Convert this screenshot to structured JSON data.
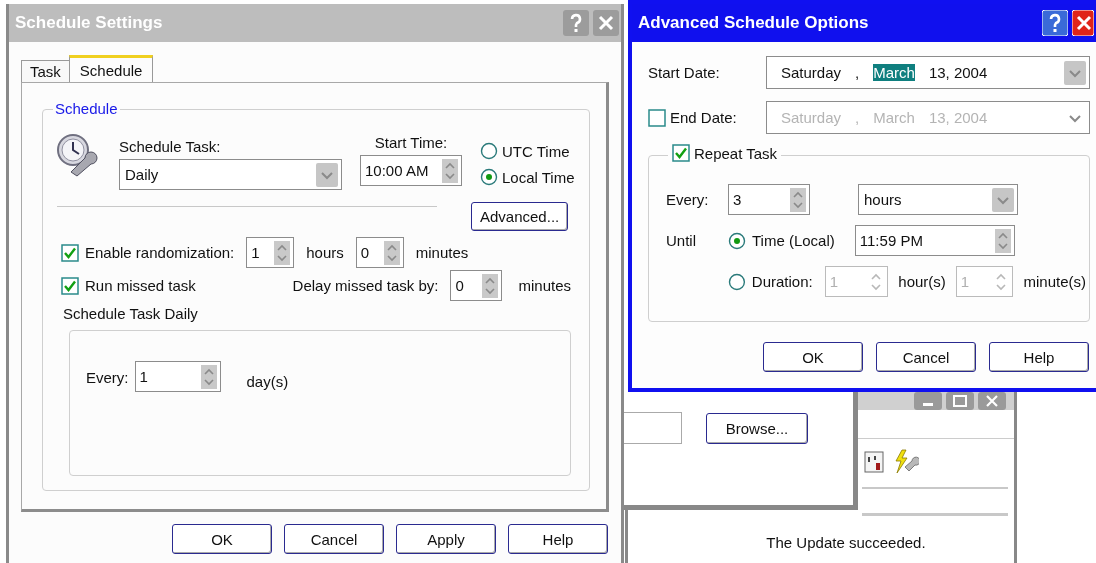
{
  "schedule_settings": {
    "title": "Schedule Settings",
    "tabs": [
      {
        "label": "Task",
        "selected": false
      },
      {
        "label": "Schedule",
        "selected": true
      }
    ],
    "group_title": "Schedule",
    "schedule_task": {
      "label": "Schedule Task:",
      "value": "Daily"
    },
    "start_time": {
      "label": "Start Time:",
      "value": "10:00 AM"
    },
    "time_zone": [
      {
        "label": "UTC Time",
        "selected": false
      },
      {
        "label": "Local Time",
        "selected": true
      }
    ],
    "advanced_button": "Advanced...",
    "randomization": {
      "label": "Enable randomization:",
      "checked": true,
      "hours": "1",
      "hours_unit": "hours",
      "minutes": "0",
      "minutes_unit": "minutes"
    },
    "run_missed": {
      "label": "Run missed task",
      "checked": true
    },
    "delay": {
      "label": "Delay missed task by:",
      "value": "0",
      "unit": "minutes"
    },
    "daily": {
      "title": "Schedule Task Daily",
      "every_label": "Every:",
      "value": "1",
      "unit": "day(s)"
    },
    "buttons": [
      "OK",
      "Cancel",
      "Apply",
      "Help"
    ]
  },
  "advanced_options": {
    "title": "Advanced Schedule Options",
    "start_date": {
      "label": "Start Date:",
      "parts": [
        {
          "text": "Saturday",
          "selected": false
        },
        {
          "text": ",",
          "selected": false
        },
        {
          "text": "March",
          "selected": true
        },
        {
          "text": "13, 2004",
          "selected": false
        }
      ]
    },
    "end_date": {
      "label": "End Date:",
      "checked": false,
      "parts": [
        {
          "text": "Saturday",
          "selected": false
        },
        {
          "text": ",",
          "selected": false
        },
        {
          "text": "March",
          "selected": false
        },
        {
          "text": "13, 2004",
          "selected": false
        }
      ]
    },
    "repeat": {
      "label": "Repeat Task",
      "checked": true,
      "every_label": "Every:",
      "every_value": "3",
      "unit": "hours",
      "until_label": "Until",
      "options": [
        {
          "kind": "time",
          "label": "Time  (Local)",
          "value": "11:59 PM",
          "selected": true
        },
        {
          "kind": "duration",
          "label": "Duration:",
          "hours": "1",
          "hours_unit": "hour(s)",
          "minutes": "1",
          "minutes_unit": "minute(s)",
          "selected": false
        }
      ]
    },
    "buttons": [
      "OK",
      "Cancel",
      "Help"
    ]
  },
  "background": {
    "browse_button": "Browse...",
    "message": "The Update succeeded."
  }
}
